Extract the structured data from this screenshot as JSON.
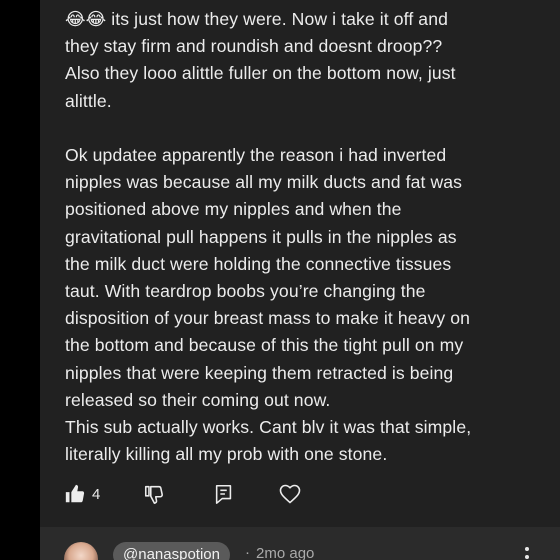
{
  "comment": {
    "paragraphs": [
      "😂😂 its just how they were. Now i take it off and",
      "they stay firm and roundish and doesnt droop??",
      "Also they looo alittle fuller on the bottom now, just",
      "alittle.",
      "",
      "Ok updatee apparently the reason i had inverted",
      "nipples was because all my milk ducts and fat was",
      "positioned above my nipples and when the",
      "gravitational pull happens it pulls in the nipples as",
      "the milk duct were holding the connective tissues",
      "taut. With teardrop boobs you’re changing the",
      "disposition of your breast mass to make it heavy on",
      "the bottom and because of this the tight pull on my",
      "nipples that were keeping them retracted is being",
      "released so their coming out now.",
      "This sub actually works. Cant blv it was that simple,",
      "literally killing all my prob with one stone."
    ],
    "actions": {
      "like_count": "4",
      "like_icon": "thumbs-up-icon",
      "dislike_icon": "thumbs-down-icon",
      "reply_icon": "reply-icon",
      "heart_icon": "heart-icon"
    }
  },
  "next_comment": {
    "handle": "@nanaspotion",
    "separator": "·",
    "timestamp": "2mo ago",
    "menu_icon": "more-vertical-icon"
  },
  "colors": {
    "page_background": "#000000",
    "card_background": "#212121",
    "text": "#ececec",
    "secondary_text": "#aaaaaa",
    "handle_pill": "#5a5a5a"
  }
}
